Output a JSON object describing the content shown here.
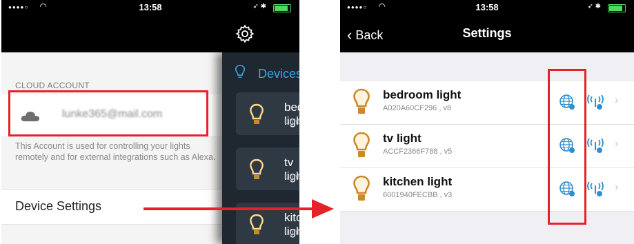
{
  "left_phone": {
    "status_bar": {
      "time": "13:58"
    },
    "cloud_account": {
      "section_label": "CLOUD ACCOUNT",
      "email": "lunke365@mail.com",
      "description": "This Account is used for controlling your lights remotely and for external integrations such as Alexa."
    },
    "device_settings_label": "Device Settings",
    "drawer": {
      "title": "Devices",
      "items": [
        {
          "name": "bedroom light",
          "sub": "Light"
        },
        {
          "name": "tv light",
          "sub": "Light"
        },
        {
          "name": "kitchen light",
          "sub": "Light"
        }
      ]
    }
  },
  "right_phone": {
    "status_bar": {
      "time": "13:58"
    },
    "nav": {
      "back_label": "Back",
      "title": "Settings"
    },
    "devices": [
      {
        "name": "bedroom light",
        "id": "A020A60CF296 , v8"
      },
      {
        "name": "tv light",
        "id": "ACCF2366F788 , v5"
      },
      {
        "name": "kitchen light",
        "id": "6001940FECBB , v3"
      }
    ]
  },
  "colors": {
    "highlight": "#e52228",
    "accent": "#3aa7e6",
    "bulb": "#c98a2b"
  },
  "icons": [
    "gear-icon",
    "cloud-icon",
    "bulb-icon",
    "globe-icon",
    "radio-signal-icon",
    "chevron-right-icon"
  ]
}
